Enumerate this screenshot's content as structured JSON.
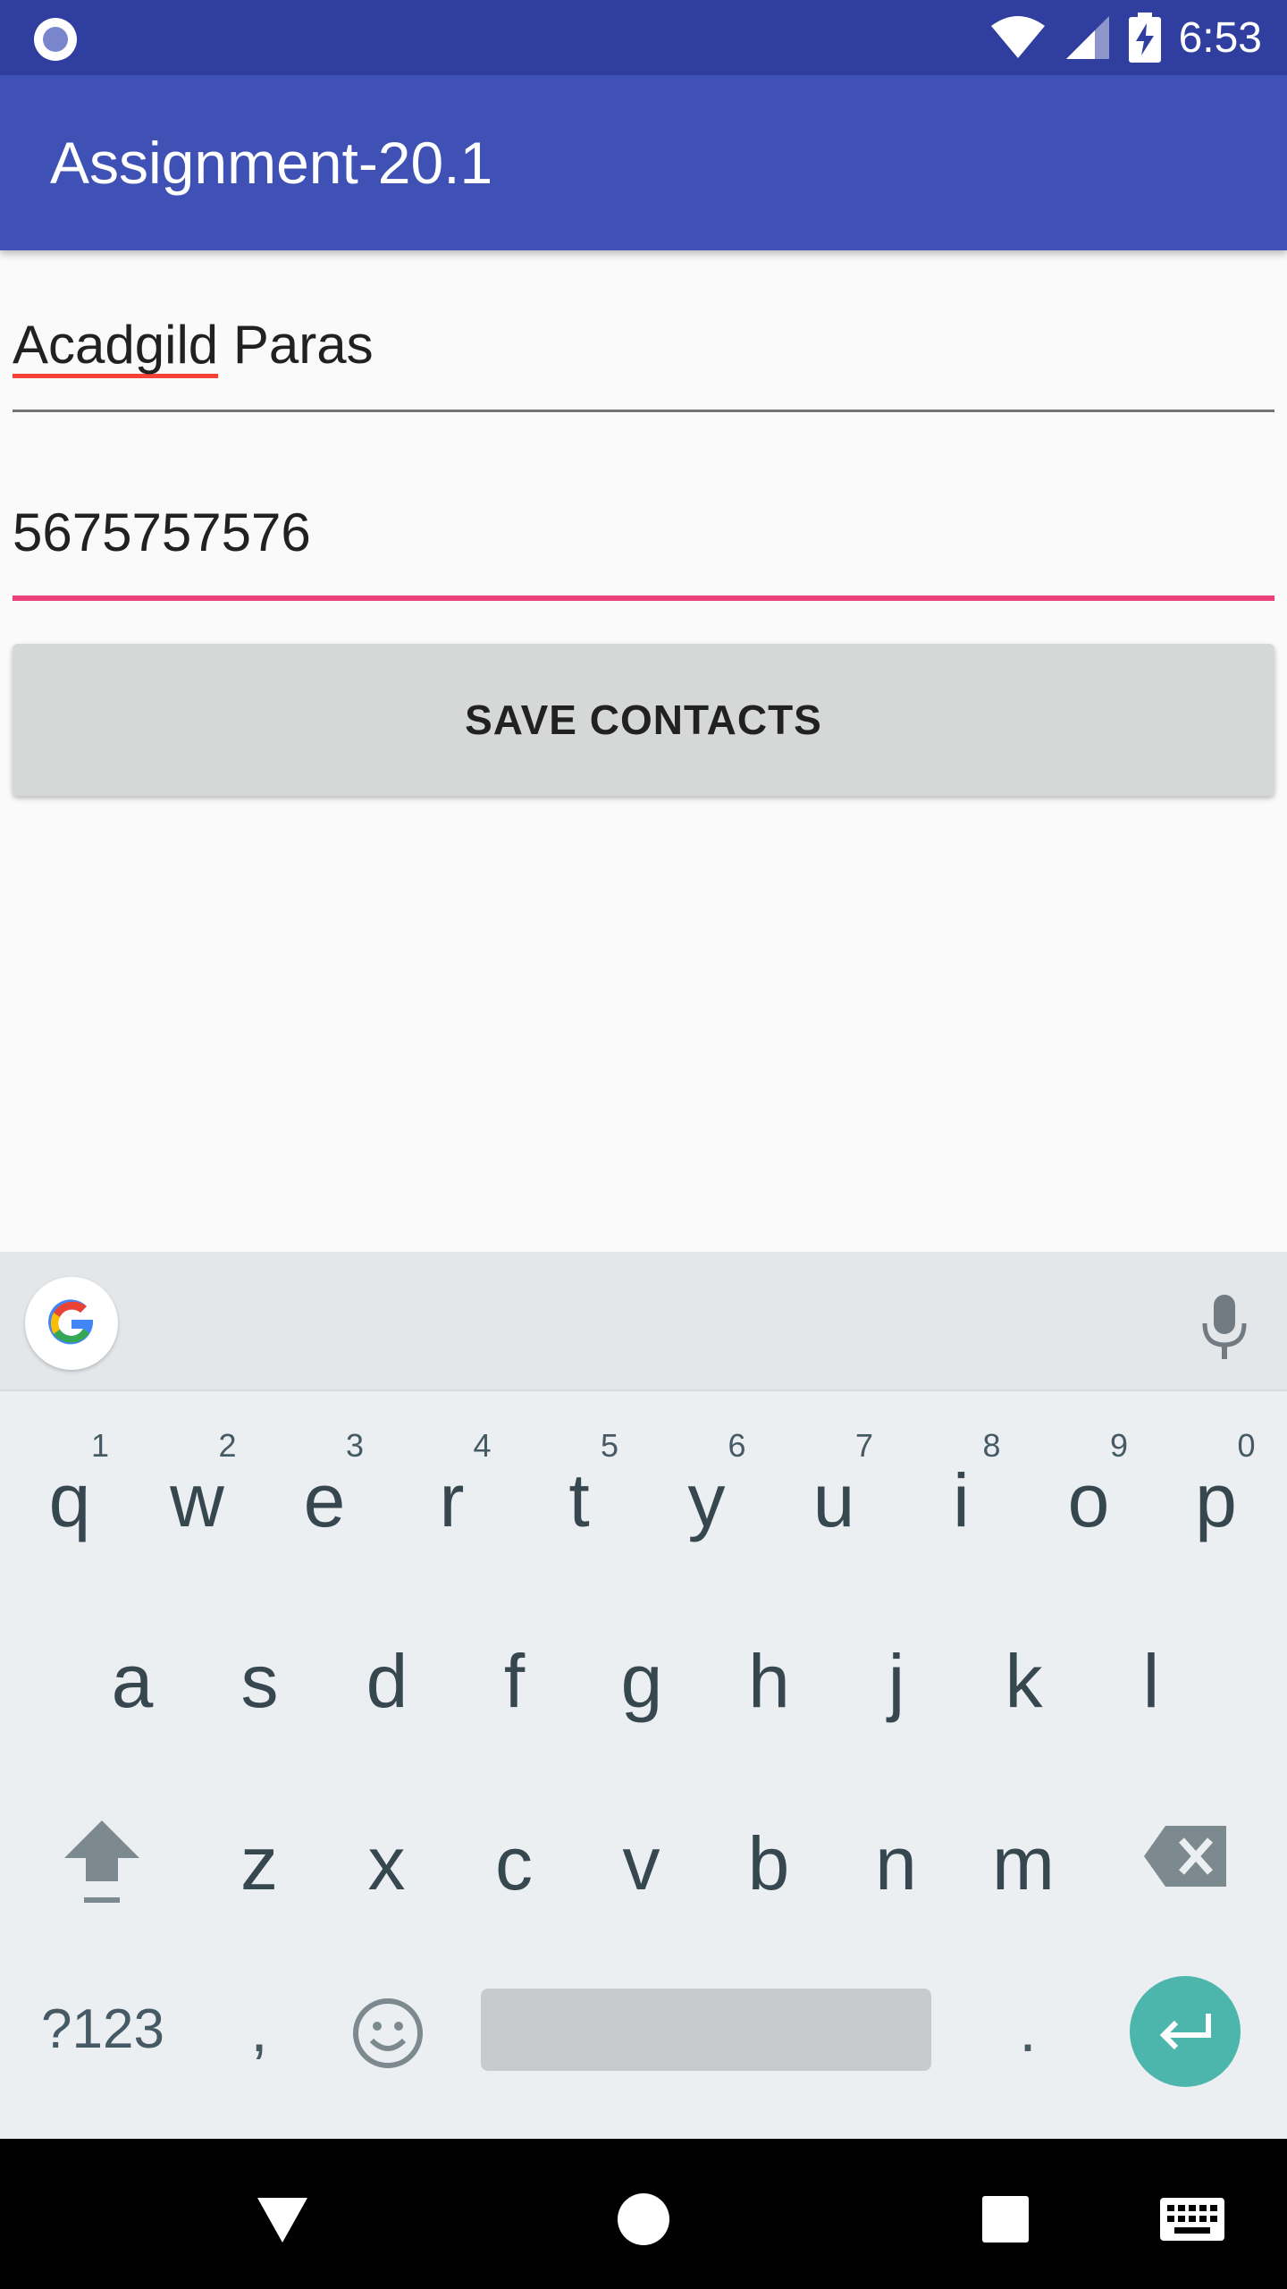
{
  "status_bar": {
    "time": "6:53",
    "icons": [
      "notification-dot-icon",
      "wifi-icon",
      "signal-icon",
      "battery-charging-icon"
    ]
  },
  "app_bar": {
    "title": "Assignment-20.1"
  },
  "form": {
    "name_field": {
      "value_part1": "Acadgild",
      "value_part2": " Paras"
    },
    "phone_field": {
      "value": "5675757576"
    },
    "save_button_label": "SAVE CONTACTS"
  },
  "keyboard": {
    "row1": [
      {
        "ch": "q",
        "hint": "1"
      },
      {
        "ch": "w",
        "hint": "2"
      },
      {
        "ch": "e",
        "hint": "3"
      },
      {
        "ch": "r",
        "hint": "4"
      },
      {
        "ch": "t",
        "hint": "5"
      },
      {
        "ch": "y",
        "hint": "6"
      },
      {
        "ch": "u",
        "hint": "7"
      },
      {
        "ch": "i",
        "hint": "8"
      },
      {
        "ch": "o",
        "hint": "9"
      },
      {
        "ch": "p",
        "hint": "0"
      }
    ],
    "row2": [
      "a",
      "s",
      "d",
      "f",
      "g",
      "h",
      "j",
      "k",
      "l"
    ],
    "row3": [
      "z",
      "x",
      "c",
      "v",
      "b",
      "n",
      "m"
    ],
    "symbols_label": "?123",
    "comma_label": ",",
    "period_label": ".",
    "icons": [
      "google-icon",
      "mic-icon",
      "shift-icon",
      "backspace-icon",
      "emoji-icon",
      "enter-icon"
    ]
  },
  "nav_bar": {
    "icons": [
      "back-icon",
      "home-icon",
      "recents-icon",
      "keyboard-switch-icon"
    ]
  },
  "colors": {
    "status_bar": "#303f9f",
    "app_bar": "#3f51b5",
    "accent": "#ec407a",
    "enter": "#4db6ac"
  }
}
